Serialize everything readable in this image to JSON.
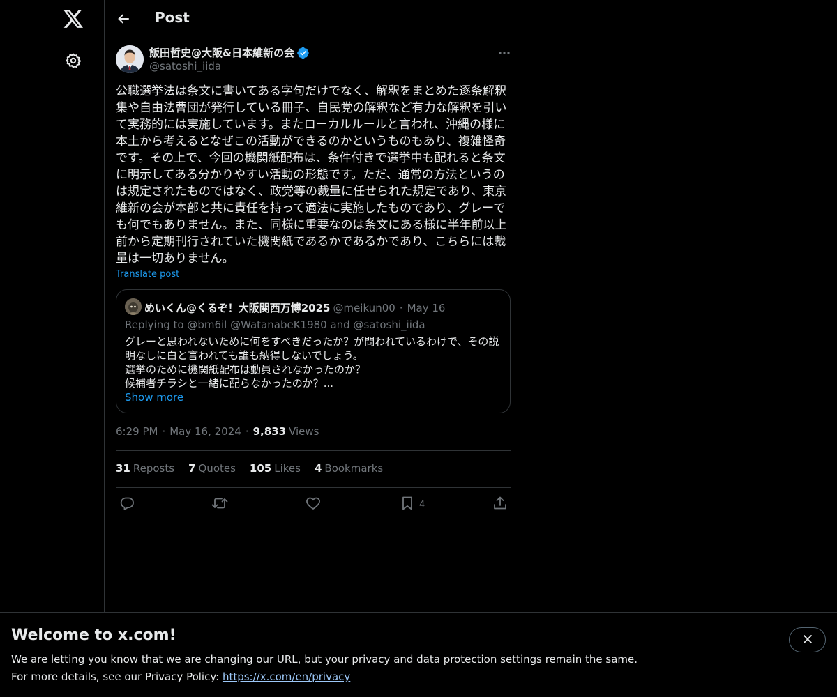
{
  "header": {
    "title": "Post"
  },
  "author": {
    "name": "飯田哲史@大阪&日本維新の会",
    "handle": "@satoshi_iida"
  },
  "tweet": {
    "text": "公職選挙法は条文に書いてある字句だけでなく、解釈をまとめた逐条解釈集や自由法曹団が発行している冊子、自民党の解釈など有力な解釈を引いて実務的には実施しています。またローカルルールと言われ、沖縄の様に本土から考えるとなぜこの活動ができるのかというものもあり、複雑怪奇です。その上で、今回の機関紙配布は、条件付きで選挙中も配れると条文に明示してある分かりやすい活動の形態です。ただ、通常の方法というのは規定されたものではなく、政党等の裁量に任せられた規定であり、東京維新の会が本部と共に責任を持って適法に実施したものであり、グレーでも何でもありません。また、同様に重要なのは条文にある様に半年前以上前から定期刊行されていた機関紙であるかであるかであり、こちらには裁量は一切ありません。",
    "translate_label": "Translate post"
  },
  "quote": {
    "name": "めいくん@くるぞ！大阪関西万博2025",
    "handle": "@meikun00",
    "separator": "·",
    "date": "May 16",
    "replying_to": "Replying to @bm6il @WatanabeK1980 and @satoshi_iida",
    "lines": [
      "グレーと思われないために何をすべきだったか？が問われているわけで、その説",
      "明なしに白と言われても誰も納得しないでしょう。",
      "選挙のために機関紙配布は動員されなかったのか？",
      "候補者チラシと一緒に配らなかったのか？..."
    ],
    "show_more": "Show more"
  },
  "meta": {
    "time": "6:29 PM",
    "separator": "·",
    "date": "May 16, 2024",
    "views_count": "9,833",
    "views_label": "Views"
  },
  "stats": {
    "reposts_count": "31",
    "reposts_label": "Reposts",
    "quotes_count": "7",
    "quotes_label": "Quotes",
    "likes_count": "105",
    "likes_label": "Likes",
    "bookmarks_count": "4",
    "bookmarks_label": "Bookmarks"
  },
  "actions": {
    "bookmark_count": "4"
  },
  "banner": {
    "title": "Welcome to x.com!",
    "line1": "We are letting you know that we are changing our URL, but your privacy and data protection settings remain the same.",
    "line2_prefix": "For more details, see our Privacy Policy: ",
    "link": "https://x.com/en/privacy"
  },
  "colors": {
    "accent": "#1d9bf0",
    "muted": "#71767b",
    "text": "#e7e9ea",
    "border": "#2f3336"
  },
  "icons": [
    "x-logo-icon",
    "settings-gear-icon",
    "back-arrow-icon",
    "verified-badge-icon",
    "more-dots-icon",
    "reply-icon",
    "repost-icon",
    "like-heart-icon",
    "bookmark-icon",
    "share-icon",
    "close-icon"
  ]
}
